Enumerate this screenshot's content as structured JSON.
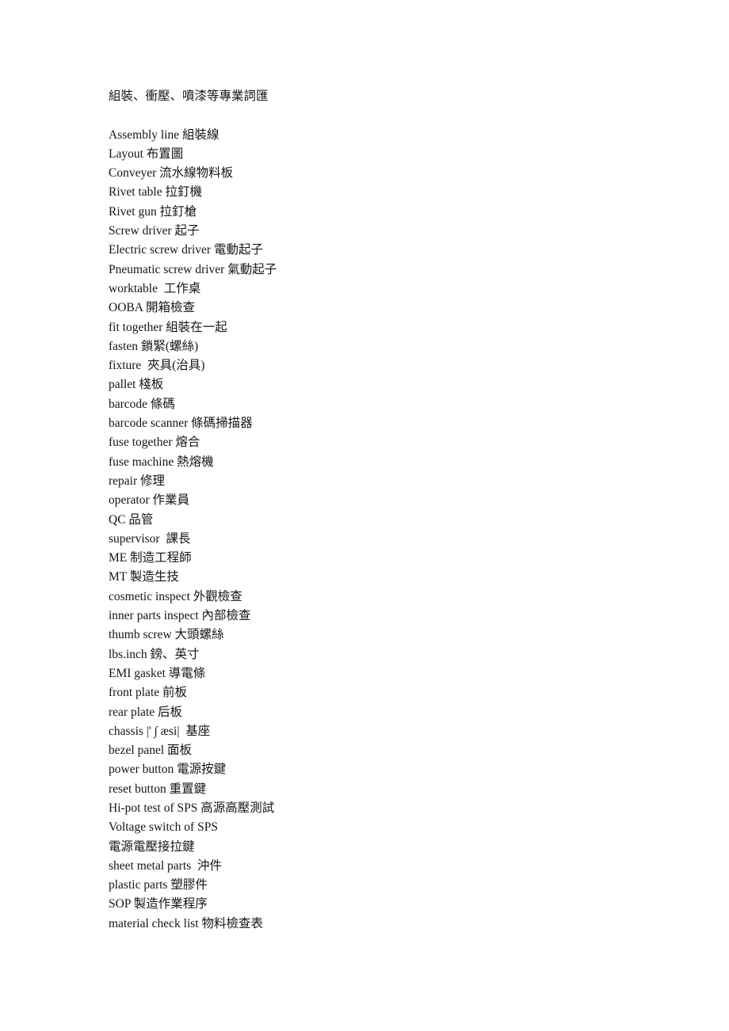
{
  "document": {
    "title": "組裝、衝壓、噴漆等專業詞匯",
    "terms": [
      "Assembly line 組裝線",
      "Layout 布置圖",
      "Conveyer 流水線物料板",
      "Rivet table 拉釘機",
      "Rivet gun 拉釘槍",
      "Screw driver 起子",
      "Electric screw driver 電動起子",
      "Pneumatic screw driver 氣動起子",
      "worktable  工作桌",
      "OOBA 開箱檢查",
      "fit together 組裝在一起",
      "fasten 鎖緊(螺絲)",
      "fixture  夾具(治具)",
      "pallet 棧板",
      "barcode 條碼",
      "barcode scanner 條碼掃描器",
      "fuse together 熔合",
      "fuse machine 熱熔機",
      "repair 修理",
      "operator 作業員",
      "QC 品管",
      "supervisor  課長",
      "ME 制造工程師",
      "MT 製造生技",
      "cosmetic inspect 外觀檢查",
      "inner parts inspect 內部檢查",
      "thumb screw 大頭螺絲",
      "lbs.inch 鎊、英寸",
      "EMI gasket 導電條",
      "front plate 前板",
      "rear plate 后板",
      "chassis |' ∫ æsi|  基座",
      "bezel panel 面板",
      "power button 電源按鍵",
      "reset button 重置鍵",
      "Hi-pot test of SPS 高源高壓測試",
      "Voltage switch of SPS",
      "電源電壓接拉鍵",
      "sheet metal parts  沖件",
      "plastic parts 塑膠件",
      "SOP 製造作業程序",
      "material check list 物料檢查表"
    ]
  }
}
